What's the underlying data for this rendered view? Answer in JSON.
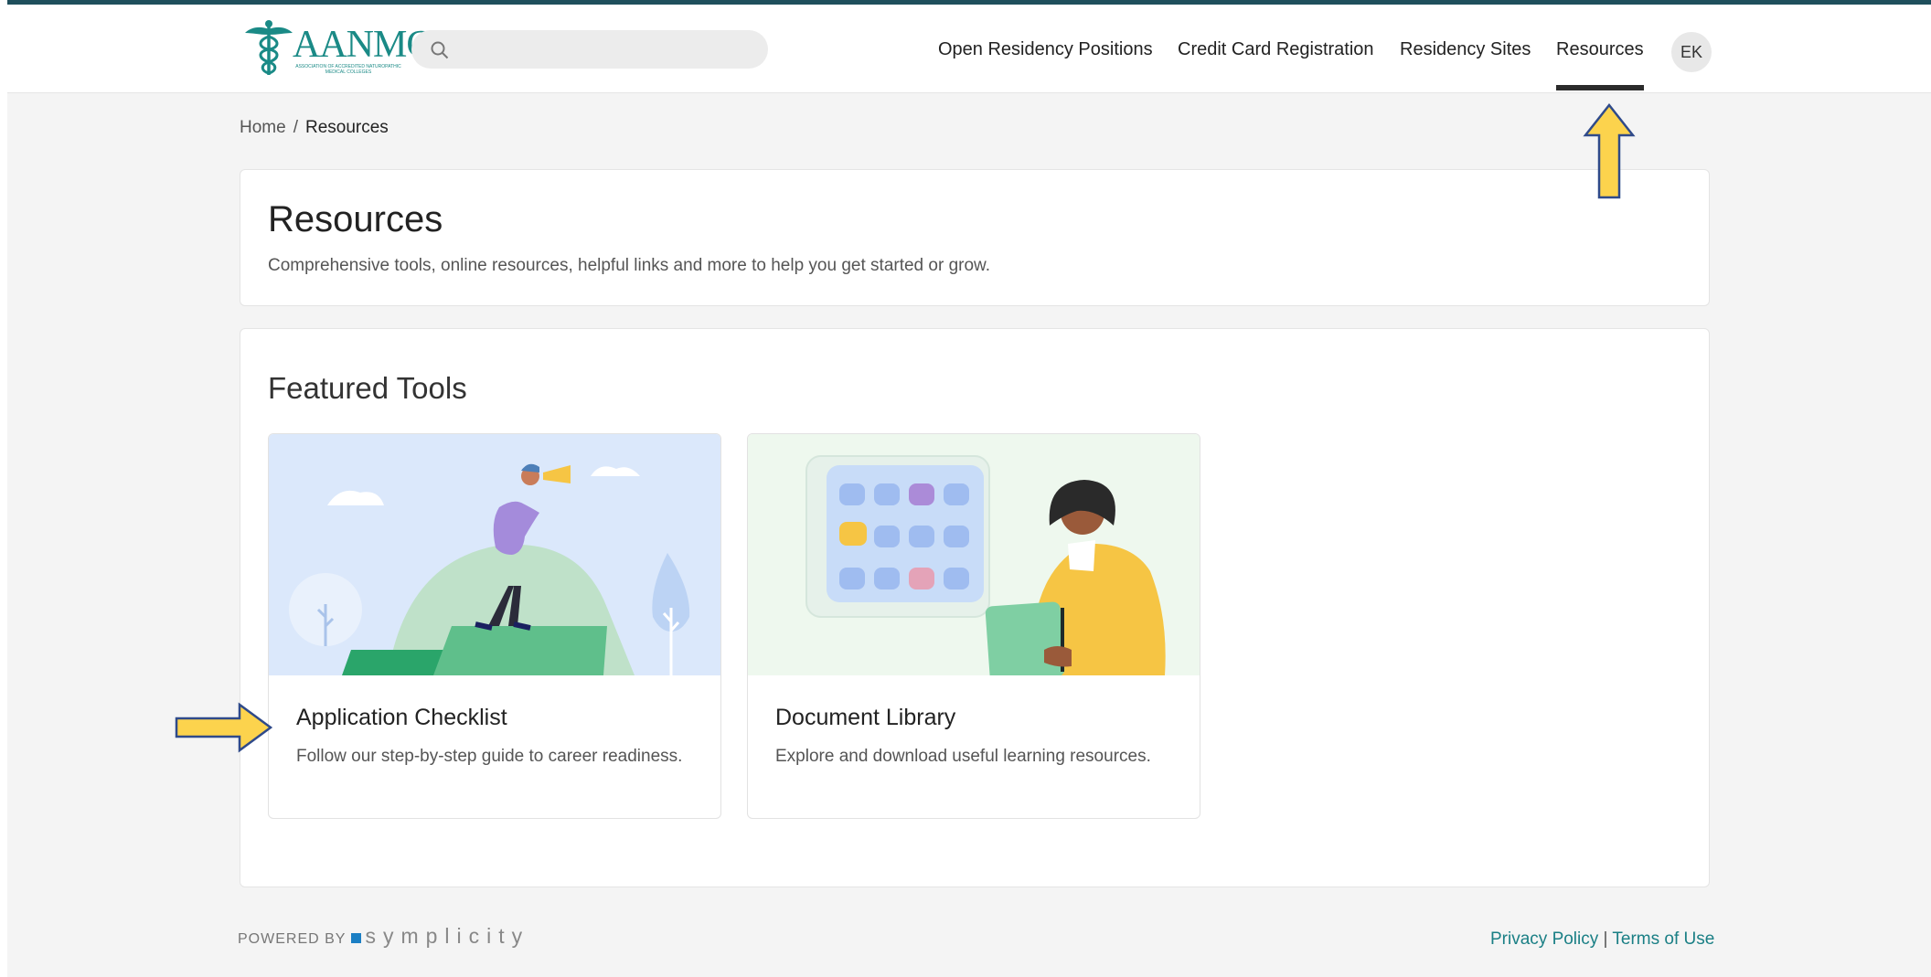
{
  "brand": {
    "logo_text": "AANMC",
    "logo_tagline": "ASSOCIATION OF ACCREDITED NATUROPATHIC MEDICAL COLLEGES"
  },
  "search": {
    "placeholder": ""
  },
  "nav": {
    "items": [
      {
        "label": "Open Residency Positions"
      },
      {
        "label": "Credit Card Registration"
      },
      {
        "label": "Residency Sites"
      },
      {
        "label": "Resources",
        "active": true
      }
    ],
    "avatar_initials": "EK"
  },
  "breadcrumb": {
    "home": "Home",
    "separator": "/",
    "current": "Resources"
  },
  "header": {
    "title": "Resources",
    "subtitle": "Comprehensive tools, online resources, helpful links and more to help you get started or grow."
  },
  "featured": {
    "title": "Featured Tools",
    "tools": [
      {
        "title": "Application Checklist",
        "description": "Follow our step-by-step guide to career readiness."
      },
      {
        "title": "Document Library",
        "description": "Explore and download useful learning resources."
      }
    ]
  },
  "footer": {
    "powered_by": "POWERED BY",
    "brand": "symplicity",
    "privacy": "Privacy Policy",
    "separator": "|",
    "terms": "Terms of Use"
  },
  "colors": {
    "accent": "#1a8a86",
    "nav_active": "#2b2b2b",
    "annotation_arrow": "#fcd34d",
    "annotation_outline": "#2f4a8a",
    "footer_link": "#1a7f85"
  },
  "icons": [
    "search-icon",
    "caduceus-icon",
    "arrow-up-annotation",
    "arrow-right-annotation"
  ]
}
